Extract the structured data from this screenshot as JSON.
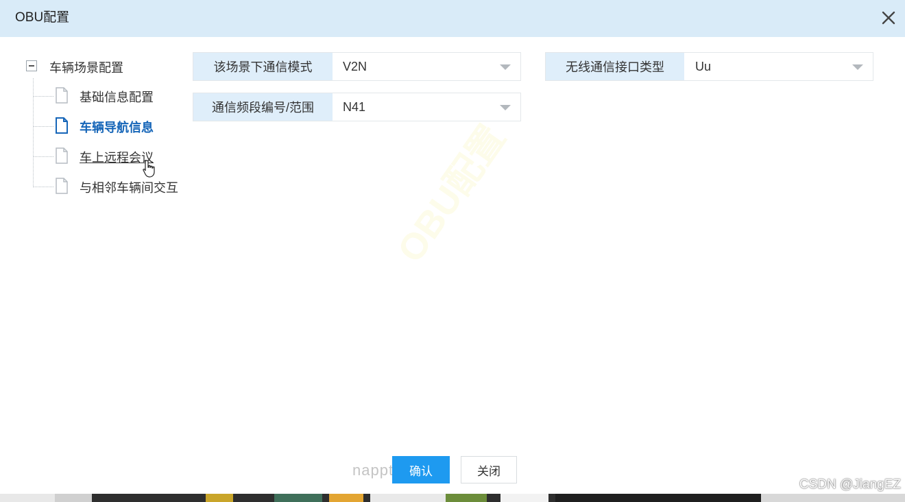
{
  "dialog": {
    "title": "OBU配置"
  },
  "tree": {
    "root_label": "车辆场景配置",
    "children": [
      {
        "label": "基础信息配置"
      },
      {
        "label": "车辆导航信息"
      },
      {
        "label": "车上远程会议"
      },
      {
        "label": "与相邻车辆间交互"
      }
    ]
  },
  "form": {
    "comm_mode": {
      "label": "该场景下通信模式",
      "value": "V2N"
    },
    "interface_type": {
      "label": "无线通信接口类型",
      "value": "Uu"
    },
    "band": {
      "label": "通信频段编号/范围",
      "value": "N41"
    }
  },
  "footer": {
    "confirm_label": "确认",
    "close_label": "关闭",
    "background_text": "nappte"
  },
  "watermark": {
    "site": "CSDN @JiangEZ"
  },
  "colors": {
    "titlebar": "#d9ebf8",
    "primary": "#1e9af0",
    "active_tree_item": "#1565b8",
    "field_label_bg": "#dfeefa"
  }
}
